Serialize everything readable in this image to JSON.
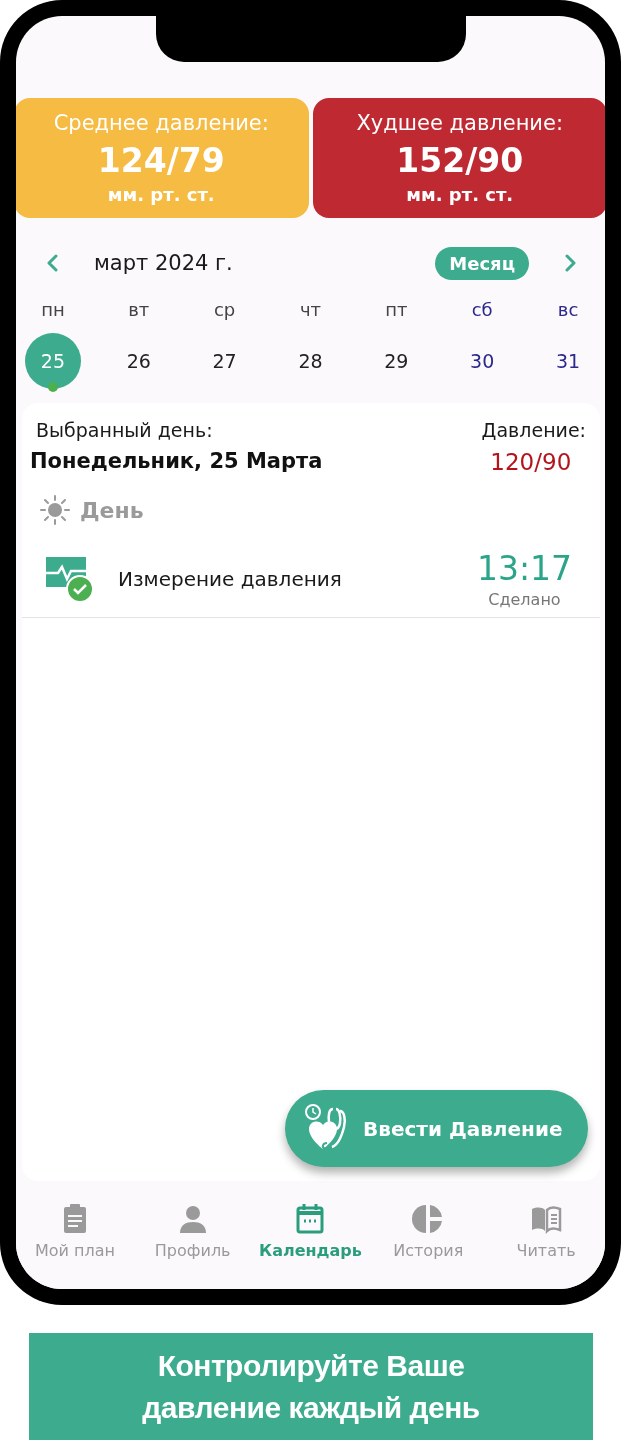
{
  "stats": [
    {
      "label": "Среднее давление:",
      "value": "124/79",
      "unit": "мм. рт. ст.",
      "color": "#f5bb42"
    },
    {
      "label": "Худшее давление:",
      "value": "152/90",
      "unit": "мм. рт. ст.",
      "color": "#be2932"
    }
  ],
  "calendar": {
    "month": "март 2024 г.",
    "mode_button": "Месяц",
    "days": [
      {
        "weekday": "пн",
        "date": "25",
        "kind": "weekday",
        "selected": true,
        "has_record": true
      },
      {
        "weekday": "вт",
        "date": "26",
        "kind": "weekday",
        "selected": false,
        "has_record": false
      },
      {
        "weekday": "ср",
        "date": "27",
        "kind": "weekday",
        "selected": false,
        "has_record": false
      },
      {
        "weekday": "чт",
        "date": "28",
        "kind": "weekday",
        "selected": false,
        "has_record": false
      },
      {
        "weekday": "пт",
        "date": "29",
        "kind": "weekday",
        "selected": false,
        "has_record": false
      },
      {
        "weekday": "сб",
        "date": "30",
        "kind": "weekend",
        "selected": false,
        "has_record": false
      },
      {
        "weekday": "вс",
        "date": "31",
        "kind": "weekend",
        "selected": false,
        "has_record": false
      }
    ]
  },
  "selected_day": {
    "label": "Выбранный день:",
    "date": "Понедельник, 25 Марта",
    "pressure_label": "Давление:",
    "pressure": "120/90",
    "period": "День",
    "entries": [
      {
        "title": "Измерение давления",
        "time": "13:17",
        "status": "Сделано",
        "done": true
      }
    ]
  },
  "fab": {
    "label": "Ввести Давление"
  },
  "nav": [
    {
      "label": "Мой план",
      "kind": "plan",
      "selected": false
    },
    {
      "label": "Профиль",
      "kind": "profile",
      "selected": false
    },
    {
      "label": "Календарь",
      "kind": "calendar",
      "selected": true
    },
    {
      "label": "История",
      "kind": "history",
      "selected": false
    },
    {
      "label": "Читать",
      "kind": "read",
      "selected": false
    }
  ],
  "banner": {
    "text": "Контролируйте Ваше давление каждый день"
  }
}
